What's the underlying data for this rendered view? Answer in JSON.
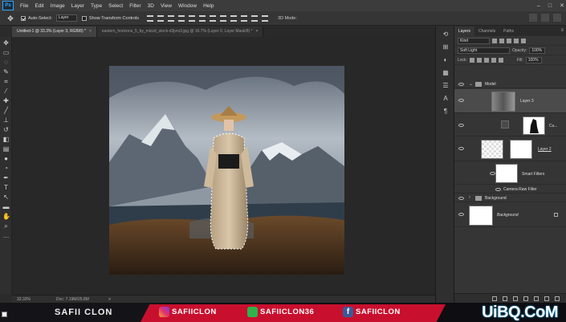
{
  "app": {
    "logo": "Ps"
  },
  "menu": [
    "File",
    "Edit",
    "Image",
    "Layer",
    "Type",
    "Select",
    "Filter",
    "3D",
    "View",
    "Window",
    "Help"
  ],
  "window_controls": [
    "–",
    "□",
    "✕"
  ],
  "options": {
    "auto_select_label": "Auto-Select:",
    "auto_select_target": "Layer",
    "show_transform_label": "Show Transform Controls",
    "mode_3d_label": "3D Mode:"
  },
  "tabs": [
    {
      "label": "Untitled-1 @ 33.3% (Layer 3, RGB/8) *",
      "close": "×"
    },
    {
      "label": "eastern_horizons_5_by_mizzd_stock-d3jvrs3.jpg @ 16.7% (Layer 0, Layer Mask/8) *",
      "close": "×"
    }
  ],
  "status": {
    "zoom": "33.33%",
    "doc": "Doc: 7.19M/25.8M",
    "arrow": ">"
  },
  "panel": {
    "tabs": [
      "Layers",
      "Channels",
      "Paths"
    ],
    "menu_icon": "≡",
    "kind_label": "Kind",
    "blend_mode": "Soft Light",
    "opacity_label": "Opacity:",
    "opacity": "100%",
    "lock_label": "Lock:",
    "fill_label": "Fill:",
    "fill": "100%",
    "layers": [
      {
        "name": "Model",
        "type": "group"
      },
      {
        "name": "Layer 3",
        "type": "layer"
      },
      {
        "name": "Cu...",
        "type": "adjustment"
      },
      {
        "name": "Layer 2",
        "type": "smart-object"
      },
      {
        "name": "Smart Filters",
        "type": "filter-mask"
      },
      {
        "name": "Camera Raw Filter",
        "type": "filter"
      },
      {
        "name": "Background",
        "type": "group"
      },
      {
        "name": "Background",
        "type": "background"
      }
    ]
  },
  "banner": {
    "name": "SAFII CLON",
    "instagram": "SAFIICLON",
    "xbox": "SAFIICLON36",
    "facebook": "SAFIICLON",
    "fb_glyph": "f",
    "watermark": "UiBQ.CoM"
  },
  "colors": {
    "brand_red": "#c8102e",
    "ps_blue": "#31a8ff"
  }
}
